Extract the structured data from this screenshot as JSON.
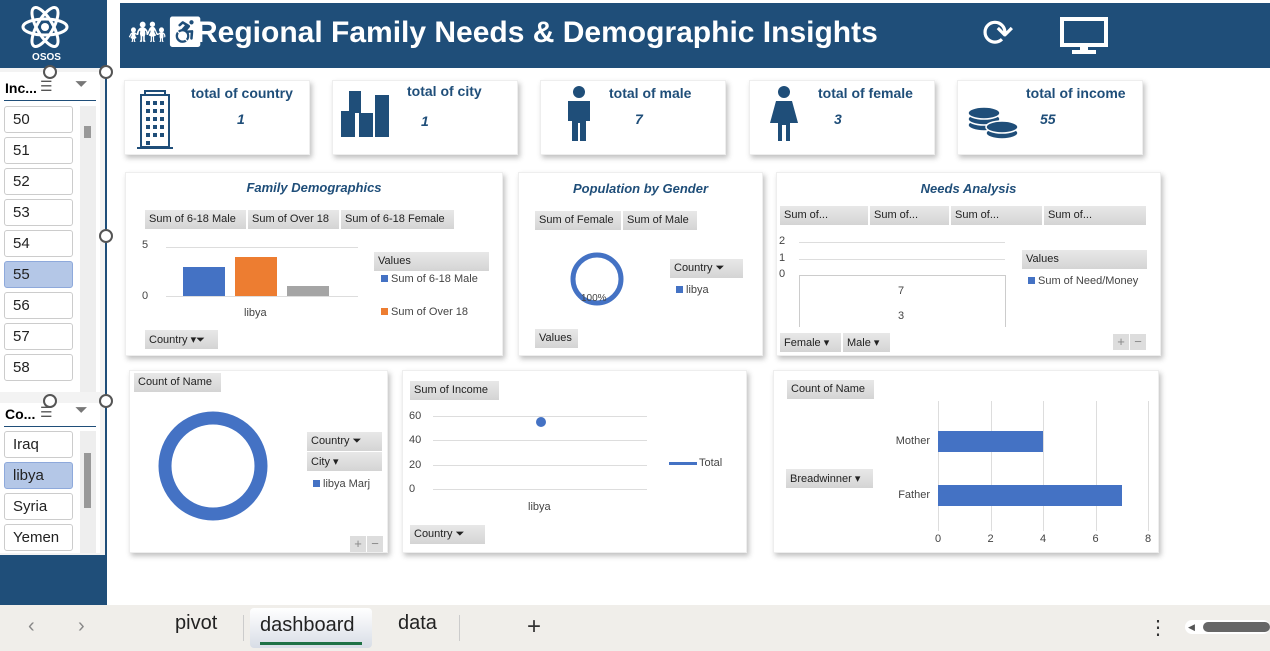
{
  "logo": {
    "text": "OSOS"
  },
  "header": {
    "title": "Regional Family Needs & Demographic Insights",
    "icons": [
      "family-icon",
      "refresh-icon",
      "monitor-icon"
    ]
  },
  "colors": {
    "navy": "#1f4e79",
    "blue": "#4472c4",
    "orange": "#ed7d31",
    "gray": "#a5a5a5",
    "selected": "#b4c7e7"
  },
  "slicers": [
    {
      "title": "Inc...",
      "items": [
        "50",
        "51",
        "52",
        "53",
        "54",
        "55",
        "56",
        "57",
        "58"
      ],
      "selected": "55"
    },
    {
      "title": "Co...",
      "items": [
        "Iraq",
        "libya",
        "Syria",
        "Yemen"
      ],
      "selected": "libya"
    }
  ],
  "kpis": [
    {
      "label": "total of country",
      "value": "1",
      "icon": "building-icon"
    },
    {
      "label": "total of city",
      "value": "1",
      "icon": "city-icon"
    },
    {
      "label": "total of male",
      "value": "7",
      "icon": "male-icon"
    },
    {
      "label": "total of female",
      "value": "3",
      "icon": "female-icon"
    },
    {
      "label": "total of income",
      "value": "55",
      "icon": "coins-icon"
    }
  ],
  "chart_data": [
    {
      "type": "bar",
      "title": "Family Demographics",
      "field_buttons": [
        "Sum of 6-18 Male",
        "Sum of Over 18",
        "Sum of 6-18 Female"
      ],
      "categories": [
        "libya"
      ],
      "series": [
        {
          "name": "Sum of 6-18 Male",
          "values": [
            3
          ]
        },
        {
          "name": "Sum of Over 18",
          "values": [
            4
          ]
        },
        {
          "name": "Sum of 6-18 Female",
          "values": [
            1
          ]
        }
      ],
      "yticks": [
        "5",
        "0"
      ],
      "ylim": [
        0,
        5
      ],
      "legend_title": "Values",
      "legend": [
        "Sum of 6-18 Male",
        "Sum of Over 18"
      ],
      "filter": "Country"
    },
    {
      "type": "pie",
      "title": "Population by Gender",
      "field_buttons": [
        "Sum of Female",
        "Sum of Male"
      ],
      "label": "100%",
      "legend_title": "Country",
      "legend": [
        "libya"
      ],
      "values_button": "Values"
    },
    {
      "type": "bar",
      "title_a": "Needs",
      "title_b": "Analysis",
      "field_buttons": [
        "Sum of...",
        "Sum of...",
        "Sum of...",
        "Sum of..."
      ],
      "yticks": [
        "2",
        "1",
        "0"
      ],
      "row_labels": [
        "7",
        "3"
      ],
      "legend_title": "Values",
      "legend": [
        "Sum of Need/Money"
      ],
      "filters": [
        "Female",
        "Male"
      ]
    },
    {
      "type": "pie",
      "field_button": "Count of Name",
      "legend_filters": [
        "Country",
        "City"
      ],
      "legend": [
        "libya Marj"
      ]
    },
    {
      "type": "line",
      "field_button": "Sum of Income",
      "categories": [
        "libya"
      ],
      "series": [
        {
          "name": "Total",
          "values": [
            55
          ]
        }
      ],
      "yticks": [
        "60",
        "40",
        "20",
        "0"
      ],
      "ylim": [
        0,
        60
      ],
      "filter": "Country"
    },
    {
      "type": "bar",
      "orientation": "horizontal",
      "field_button": "Count of Name",
      "categories": [
        "Mother",
        "Father"
      ],
      "values": [
        4,
        7
      ],
      "xticks": [
        "0",
        "2",
        "4",
        "6",
        "8"
      ],
      "xlim": [
        0,
        8
      ],
      "filter": "Breadwinner"
    }
  ],
  "tabs": {
    "items": [
      "pivot",
      "dashboard",
      "data"
    ],
    "active": "dashboard",
    "add": "+"
  }
}
